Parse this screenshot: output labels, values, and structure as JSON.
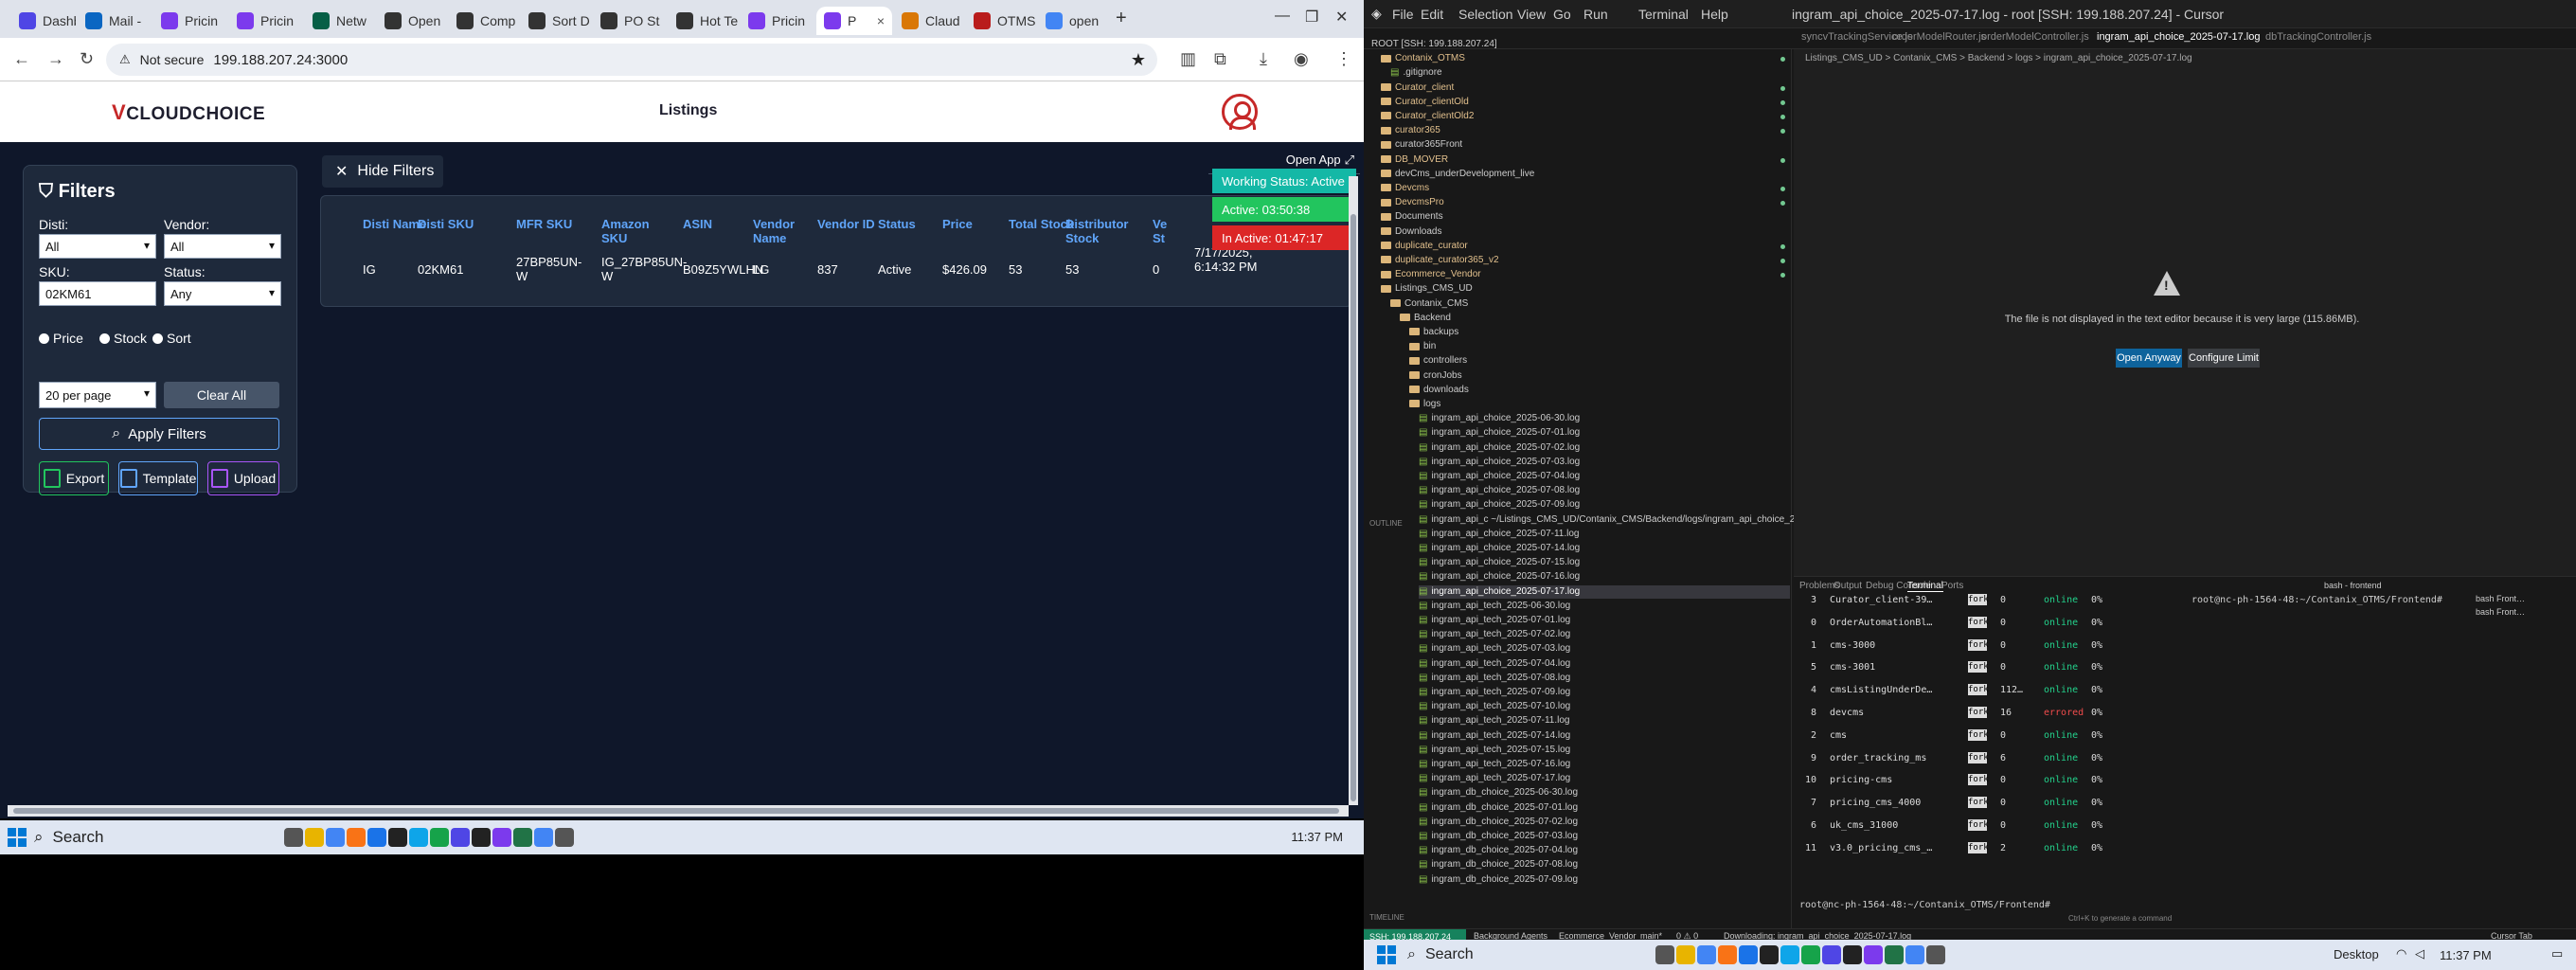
{
  "left": {
    "tabs": [
      {
        "label": "Dashb",
        "color": "#4f46e5"
      },
      {
        "label": "Mail -",
        "color": "#0a66c2"
      },
      {
        "label": "Pricin",
        "color": "#7c3aed"
      },
      {
        "label": "Pricin",
        "color": "#7c3aed"
      },
      {
        "label": "Netw",
        "color": "#065f46"
      },
      {
        "label": "Open",
        "color": "#333333"
      },
      {
        "label": "Comp",
        "color": "#333333"
      },
      {
        "label": "Sort D",
        "color": "#333333"
      },
      {
        "label": "PO St",
        "color": "#333333"
      },
      {
        "label": "Hot Te",
        "color": "#333333"
      },
      {
        "label": "Pricin",
        "color": "#7c3aed"
      },
      {
        "label": "P",
        "color": "#7c3aed"
      },
      {
        "label": "Claud",
        "color": "#d97706"
      },
      {
        "label": "OTMS",
        "color": "#b91c1c"
      },
      {
        "label": "open",
        "color": "#4285f4"
      }
    ],
    "tab_close": "×",
    "new_tab": "+",
    "nav": {
      "back": "←",
      "forward": "→",
      "reload": "↻"
    },
    "omnibox": {
      "security": "Not secure",
      "url": "199.188.207.24:3000"
    },
    "site": {
      "brand": "CLOUDCHOICE",
      "brand_mark": "V",
      "nav_listings": "Listings",
      "filters": {
        "title": "Filters",
        "disti_label": "Disti:",
        "disti_value": "All",
        "vendor_label": "Vendor:",
        "vendor_value": "All",
        "sku_label": "SKU:",
        "sku_value": "02KM61",
        "status_label": "Status:",
        "status_value": "Any",
        "radio_price": "Price",
        "radio_stock": "Stock",
        "radio_sort": "Sort",
        "per_page": "20 per page",
        "clear_all": "Clear All",
        "apply": "Apply Filters",
        "export": "Export",
        "template": "Template",
        "upload": "Upload"
      },
      "hide_filters": "Hide Filters",
      "table": {
        "headers": [
          "Disti Name",
          "Disti SKU",
          "MFR SKU",
          "Amazon SKU",
          "ASIN",
          "Vendor Name",
          "Vendor ID",
          "Status",
          "Price",
          "Total Stock",
          "Distributor Stock",
          "Ve St"
        ],
        "row": [
          "IG",
          "02KM61",
          "27BP85UN-W",
          "IG_27BP85UN-W",
          "B09Z5YWLHN",
          "LG",
          "837",
          "Active",
          "$426.09",
          "53",
          "53",
          "0",
          "7/17/2025, 6:14:32 PM"
        ]
      },
      "open_app": "Open App",
      "working_status": "Working Status: Active",
      "active_timer": "Active: 03:50:38",
      "inactive_timer": "In Active: 01:47:17",
      "status_colors": {
        "working": "#14b8a6",
        "active": "#22c55e",
        "inactive": "#dc2626"
      }
    },
    "taskbar": {
      "search": "Search",
      "time": "11:37 PM"
    }
  },
  "right": {
    "menu": [
      "File",
      "Edit",
      "Selection",
      "View",
      "Go",
      "Run",
      "Terminal",
      "Help"
    ],
    "window_title": "ingram_api_choice_2025-07-17.log - root [SSH: 199.188.207.24] - Cursor",
    "editor_tabs": [
      "syncvTrackingService.js",
      "orderModelRouter.js",
      "orderModelController.js",
      "ingram_api_choice_2025-07-17.log",
      "dbTrackingController.js"
    ],
    "breadcrumb": "Listings_CMS_UD > Contanix_CMS > Backend > logs > ingram_api_choice_2025-07-17.log",
    "tree": [
      {
        "t": "ROOT [SSH: 199.188.207.24]",
        "c": "",
        "d": 0
      },
      {
        "t": "Contanix_OTMS",
        "c": "y",
        "d": 1,
        "f": true
      },
      {
        "t": ".gitignore",
        "c": "",
        "d": 2
      },
      {
        "t": "Curator_client",
        "c": "y",
        "d": 1,
        "f": true
      },
      {
        "t": "Curator_clientOld",
        "c": "y",
        "d": 1,
        "f": true
      },
      {
        "t": "Curator_clientOld2",
        "c": "y",
        "d": 1,
        "f": true
      },
      {
        "t": "curator365",
        "c": "y",
        "d": 1,
        "f": true
      },
      {
        "t": "curator365Front",
        "c": "",
        "d": 1,
        "f": true
      },
      {
        "t": "DB_MOVER",
        "c": "y",
        "d": 1,
        "f": true
      },
      {
        "t": "devCms_underDevelopment_live",
        "c": "",
        "d": 1,
        "f": true
      },
      {
        "t": "Devcms",
        "c": "y",
        "d": 1,
        "f": true
      },
      {
        "t": "DevcmsPro",
        "c": "y",
        "d": 1,
        "f": true
      },
      {
        "t": "Documents",
        "c": "",
        "d": 1,
        "f": true
      },
      {
        "t": "Downloads",
        "c": "",
        "d": 1,
        "f": true
      },
      {
        "t": "duplicate_curator",
        "c": "y",
        "d": 1,
        "f": true
      },
      {
        "t": "duplicate_curator365_v2",
        "c": "y",
        "d": 1,
        "f": true
      },
      {
        "t": "Ecommerce_Vendor",
        "c": "y",
        "d": 1,
        "f": true
      },
      {
        "t": "Listings_CMS_UD",
        "c": "",
        "d": 1,
        "f": true
      },
      {
        "t": "Contanix_CMS",
        "c": "",
        "d": 2,
        "f": true
      },
      {
        "t": "Backend",
        "c": "",
        "d": 3,
        "f": true
      },
      {
        "t": "backups",
        "c": "",
        "d": 4,
        "f": true
      },
      {
        "t": "bin",
        "c": "",
        "d": 4,
        "f": true
      },
      {
        "t": "controllers",
        "c": "",
        "d": 4,
        "f": true
      },
      {
        "t": "cronJobs",
        "c": "",
        "d": 4,
        "f": true
      },
      {
        "t": "downloads",
        "c": "",
        "d": 4,
        "f": true
      },
      {
        "t": "logs",
        "c": "",
        "d": 4,
        "f": true
      },
      {
        "t": "ingram_api_choice_2025-06-30.log",
        "c": "",
        "d": 5
      },
      {
        "t": "ingram_api_choice_2025-07-01.log",
        "c": "",
        "d": 5
      },
      {
        "t": "ingram_api_choice_2025-07-02.log",
        "c": "",
        "d": 5
      },
      {
        "t": "ingram_api_choice_2025-07-03.log",
        "c": "",
        "d": 5
      },
      {
        "t": "ingram_api_choice_2025-07-04.log",
        "c": "",
        "d": 5
      },
      {
        "t": "ingram_api_choice_2025-07-08.log",
        "c": "",
        "d": 5
      },
      {
        "t": "ingram_api_choice_2025-07-09.log",
        "c": "",
        "d": 5
      },
      {
        "t": "ingram_api_c ~/Listings_CMS_UD/Contanix_CMS/Backend/logs/ingram_api_choice_2025-07-09.log",
        "c": "",
        "d": 5
      },
      {
        "t": "ingram_api_choice_2025-07-11.log",
        "c": "",
        "d": 5
      },
      {
        "t": "ingram_api_choice_2025-07-14.log",
        "c": "",
        "d": 5
      },
      {
        "t": "ingram_api_choice_2025-07-15.log",
        "c": "",
        "d": 5
      },
      {
        "t": "ingram_api_choice_2025-07-16.log",
        "c": "",
        "d": 5
      },
      {
        "t": "ingram_api_choice_2025-07-17.log",
        "c": "sel",
        "d": 5
      },
      {
        "t": "ingram_api_tech_2025-06-30.log",
        "c": "",
        "d": 5
      },
      {
        "t": "ingram_api_tech_2025-07-01.log",
        "c": "",
        "d": 5
      },
      {
        "t": "ingram_api_tech_2025-07-02.log",
        "c": "",
        "d": 5
      },
      {
        "t": "ingram_api_tech_2025-07-03.log",
        "c": "",
        "d": 5
      },
      {
        "t": "ingram_api_tech_2025-07-04.log",
        "c": "",
        "d": 5
      },
      {
        "t": "ingram_api_tech_2025-07-08.log",
        "c": "",
        "d": 5
      },
      {
        "t": "ingram_api_tech_2025-07-09.log",
        "c": "",
        "d": 5
      },
      {
        "t": "ingram_api_tech_2025-07-10.log",
        "c": "",
        "d": 5
      },
      {
        "t": "ingram_api_tech_2025-07-11.log",
        "c": "",
        "d": 5
      },
      {
        "t": "ingram_api_tech_2025-07-14.log",
        "c": "",
        "d": 5
      },
      {
        "t": "ingram_api_tech_2025-07-15.log",
        "c": "",
        "d": 5
      },
      {
        "t": "ingram_api_tech_2025-07-16.log",
        "c": "",
        "d": 5
      },
      {
        "t": "ingram_api_tech_2025-07-17.log",
        "c": "",
        "d": 5
      },
      {
        "t": "ingram_db_choice_2025-06-30.log",
        "c": "",
        "d": 5
      },
      {
        "t": "ingram_db_choice_2025-07-01.log",
        "c": "",
        "d": 5
      },
      {
        "t": "ingram_db_choice_2025-07-02.log",
        "c": "",
        "d": 5
      },
      {
        "t": "ingram_db_choice_2025-07-03.log",
        "c": "",
        "d": 5
      },
      {
        "t": "ingram_db_choice_2025-07-04.log",
        "c": "",
        "d": 5
      },
      {
        "t": "ingram_db_choice_2025-07-08.log",
        "c": "",
        "d": 5
      },
      {
        "t": "ingram_db_choice_2025-07-09.log",
        "c": "",
        "d": 5
      }
    ],
    "large_file_msg": "The file is not displayed in the text editor because it is very large (115.86MB).",
    "open_anyway": "Open Anyway",
    "configure_limit": "Configure Limit",
    "panel_tabs": [
      "Problems",
      "Output",
      "Debug Console",
      "Terminal",
      "Ports"
    ],
    "pm2": [
      {
        "id": "3",
        "name": "Curator_client-39…",
        "mode": "fork",
        "restarts": "0",
        "status": "online",
        "cpu": "0%"
      },
      {
        "id": "0",
        "name": "OrderAutomationBl…",
        "mode": "fork",
        "restarts": "0",
        "status": "online",
        "cpu": "0%"
      },
      {
        "id": "1",
        "name": "cms-3000",
        "mode": "fork",
        "restarts": "0",
        "status": "online",
        "cpu": "0%"
      },
      {
        "id": "5",
        "name": "cms-3001",
        "mode": "fork",
        "restarts": "0",
        "status": "online",
        "cpu": "0%"
      },
      {
        "id": "4",
        "name": "cmsListingUnderDe…",
        "mode": "fork",
        "restarts": "112…",
        "status": "online",
        "cpu": "0%"
      },
      {
        "id": "8",
        "name": "devcms",
        "mode": "fork",
        "restarts": "16",
        "status": "errored",
        "cpu": "0%"
      },
      {
        "id": "2",
        "name": "cms",
        "mode": "fork",
        "restarts": "0",
        "status": "online",
        "cpu": "0%"
      },
      {
        "id": "9",
        "name": "order_tracking_ms",
        "mode": "fork",
        "restarts": "6",
        "status": "online",
        "cpu": "0%"
      },
      {
        "id": "10",
        "name": "pricing-cms",
        "mode": "fork",
        "restarts": "0",
        "status": "online",
        "cpu": "0%"
      },
      {
        "id": "7",
        "name": "pricing_cms_4000",
        "mode": "fork",
        "restarts": "0",
        "status": "online",
        "cpu": "0%"
      },
      {
        "id": "6",
        "name": "uk_cms_31000",
        "mode": "fork",
        "restarts": "0",
        "status": "online",
        "cpu": "0%"
      },
      {
        "id": "11",
        "name": "v3.0_pricing_cms_…",
        "mode": "fork",
        "restarts": "2",
        "status": "online",
        "cpu": "0%"
      }
    ],
    "prompt_right": "root@nc-ph-1564-48:~/Contanix_OTMS/Frontend#",
    "prompt_bottom": "root@nc-ph-1564-48:~/Contanix_OTMS/Frontend#",
    "terminals": [
      "bash Front…",
      "bash Front…"
    ],
    "terminal_label": "bash - frontend",
    "ssh": "SSH: 199.188.207.24",
    "status_items": [
      "Background Agents",
      "Ecommerce_Vendor",
      "main*",
      "0 ⚠ 0",
      "Downloading: ingram_api_choice_2025-07-17.log",
      "Ctrl+K to generate a command",
      "Cursor Tab"
    ],
    "outline": "OUTLINE",
    "timeline": "TIMELINE",
    "taskbar": {
      "search": "Search",
      "desktop": "Desktop",
      "time": "11:37 PM"
    }
  }
}
